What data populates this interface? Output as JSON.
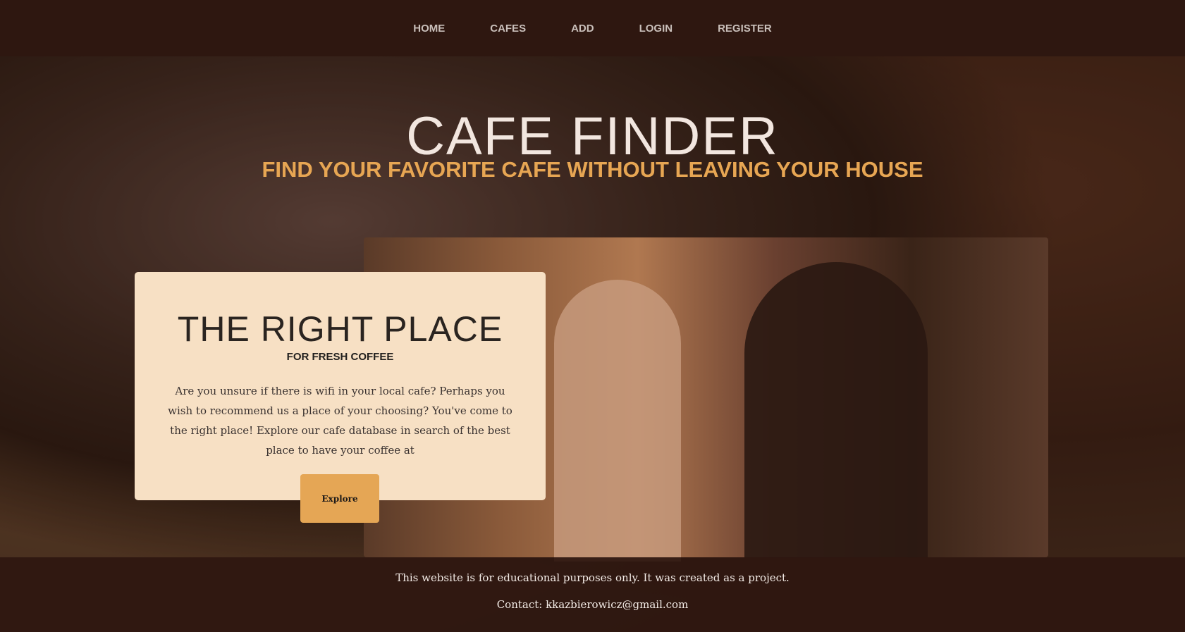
{
  "nav": {
    "items": [
      "HOME",
      "CAFES",
      "ADD",
      "LOGIN",
      "REGISTER"
    ]
  },
  "hero": {
    "title": "CAFE FINDER",
    "subtitle": "FIND YOUR FAVORITE CAFE WITHOUT LEAVING YOUR HOUSE"
  },
  "card": {
    "title": "THE RIGHT PLACE",
    "subtitle": "FOR FRESH COFFEE",
    "body": "Are you unsure if there is wifi in your local cafe? Perhaps you wish to recommend us a place of your choosing? You've come to the right place! Explore our cafe database in search of the best place to have your coffee at",
    "button": "Explore"
  },
  "footer": {
    "line1": "This website is for educational purposes only. It was created as a project.",
    "line2": "Contact: kkazbierowicz@gmail.com"
  },
  "colors": {
    "accent": "#e5a655",
    "nav_bg": "#2e1710",
    "card_bg": "#f7e0c4"
  }
}
